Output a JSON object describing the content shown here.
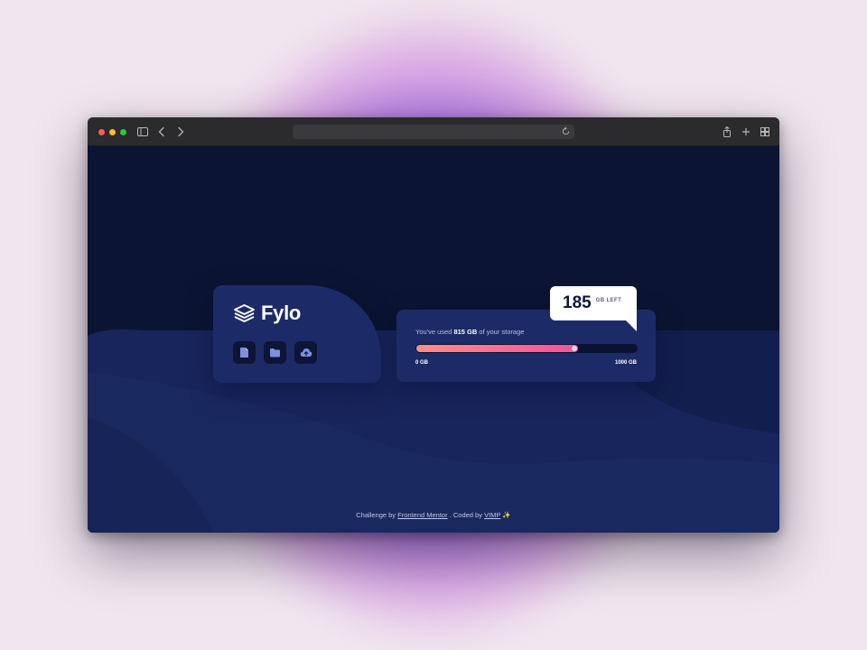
{
  "app": {
    "logo_text": "Fylo"
  },
  "logo_card": {
    "buttons": [
      {
        "icon": "document-icon"
      },
      {
        "icon": "folder-icon"
      },
      {
        "icon": "upload-cloud-icon"
      }
    ]
  },
  "usage": {
    "text_prefix": "You've used",
    "used_amount": "815 GB",
    "text_suffix": "of your storage",
    "progress_fraction": 0.815,
    "min_label": "0 GB",
    "max_label": "1000 GB"
  },
  "bubble": {
    "remaining": "185",
    "unit": "GB LEFT"
  },
  "footer": {
    "challenge_by": "Challenge by",
    "frontend_mentor": "Frontend Mentor",
    "separator": ".",
    "coded_by": "Coded by",
    "author": "VIMP",
    "sparkle": "✨"
  },
  "colors": {
    "background": "#0b1432",
    "card": "#1c2b67",
    "gradient_start": "#f7908a",
    "gradient_end": "#f1539c"
  }
}
